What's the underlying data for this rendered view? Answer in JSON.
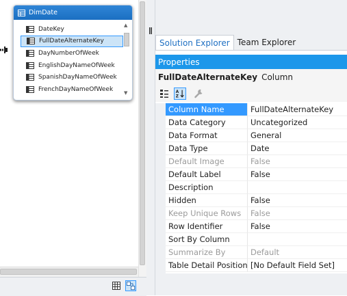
{
  "diagram": {
    "table": {
      "name": "DimDate",
      "columns": [
        {
          "label": "DateKey",
          "selected": false
        },
        {
          "label": "FullDateAlternateKey",
          "selected": true
        },
        {
          "label": "DayNumberOfWeek",
          "selected": false
        },
        {
          "label": "EnglishDayNameOfWeek",
          "selected": false
        },
        {
          "label": "SpanishDayNameOfWeek",
          "selected": false
        },
        {
          "label": "FrenchDayNameOfWeek",
          "selected": false
        }
      ]
    }
  },
  "tabs": [
    {
      "label": "Solution Explorer",
      "active": true
    },
    {
      "label": "Team Explorer",
      "active": false
    }
  ],
  "properties": {
    "title": "Properties",
    "object_name": "FullDateAlternateKey",
    "object_type": "Column",
    "rows": [
      {
        "name": "Column Name",
        "value": "FullDateAlternateKey",
        "selected": true,
        "disabled": false
      },
      {
        "name": "Data Category",
        "value": "Uncategorized",
        "selected": false,
        "disabled": false
      },
      {
        "name": "Data Format",
        "value": "General",
        "selected": false,
        "disabled": false
      },
      {
        "name": "Data Type",
        "value": "Date",
        "selected": false,
        "disabled": false
      },
      {
        "name": "Default Image",
        "value": "False",
        "selected": false,
        "disabled": true
      },
      {
        "name": "Default Label",
        "value": "False",
        "selected": false,
        "disabled": false
      },
      {
        "name": "Description",
        "value": "",
        "selected": false,
        "disabled": false
      },
      {
        "name": "Hidden",
        "value": "False",
        "selected": false,
        "disabled": false
      },
      {
        "name": "Keep Unique Rows",
        "value": "False",
        "selected": false,
        "disabled": true
      },
      {
        "name": "Row Identifier",
        "value": "False",
        "selected": false,
        "disabled": false
      },
      {
        "name": "Sort By Column",
        "value": "",
        "selected": false,
        "disabled": false
      },
      {
        "name": "Summarize By",
        "value": "Default",
        "selected": false,
        "disabled": true
      },
      {
        "name": "Table Detail Position",
        "value": "[No Default Field Set]",
        "selected": false,
        "disabled": false
      }
    ]
  },
  "icons": {
    "table": "table-icon",
    "column": "column-icon",
    "categorized": "categorized-icon",
    "alphabetical": "alphabetical-sort-icon",
    "property_pages": "wrench-icon",
    "grid_view": "grid-view-icon",
    "diagram_view": "diagram-view-icon"
  },
  "colors": {
    "accent": "#1c97ea",
    "selection": "#3399ff",
    "table_header": "#2f85d6"
  }
}
